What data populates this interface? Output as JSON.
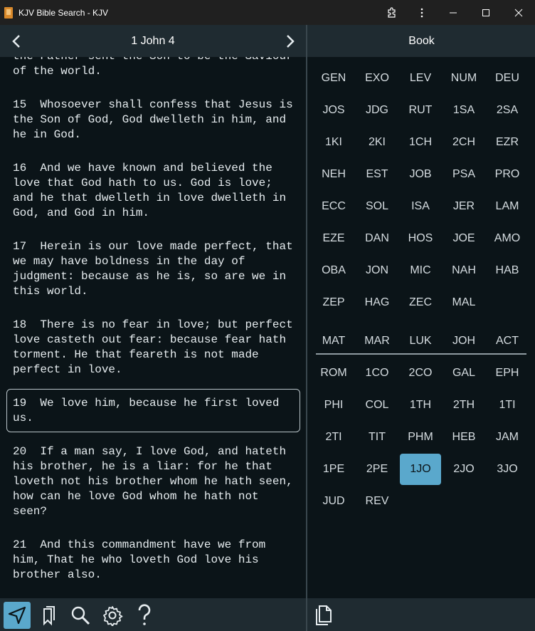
{
  "window": {
    "title": "KJV Bible Search - KJV",
    "icons": [
      "app-book-icon",
      "extensions-icon",
      "more-vert-icon",
      "minimize-icon",
      "maximize-icon",
      "close-icon"
    ]
  },
  "reader": {
    "chapter_title": "1 John 4",
    "prev_icon": "chevron-left-icon",
    "next_icon": "chevron-right-icon",
    "verses": [
      {
        "lines": [
          "the Father sent the Son to be the Saviour",
          "of the world."
        ]
      },
      {
        "lines": [
          "15  Whosoever shall confess that Jesus is",
          "the Son of God, God dwelleth in him, and",
          "he in God."
        ]
      },
      {
        "lines": [
          "16  And we have known and believed the",
          "love that God hath to us. God is love;",
          "and he that dwelleth in love dwelleth in",
          "God, and God in him."
        ]
      },
      {
        "lines": [
          "17  Herein is our love made perfect, that",
          "we may have boldness in the day of",
          "judgment: because as he is, so are we in",
          "this world."
        ]
      },
      {
        "lines": [
          "18  There is no fear in love; but perfect",
          "love casteth out fear: because fear hath",
          "torment. He that feareth is not made",
          "perfect in love."
        ]
      },
      {
        "lines": [
          "19  We love him, because he first loved",
          "us."
        ]
      },
      {
        "lines": [
          "20  If a man say, I love God, and hateth",
          "his brother, he is a liar: for he that",
          "loveth not his brother whom he hath seen,",
          "how can he love God whom he hath not",
          "seen?"
        ]
      },
      {
        "lines": [
          "21  And this commandment have we from",
          "him, That he who loveth God love his",
          "brother also."
        ]
      }
    ],
    "selected_verse_index": 5
  },
  "bottom_toolbar": {
    "buttons": [
      {
        "icon": "navigate-icon",
        "active": true
      },
      {
        "icon": "bookmarks-icon",
        "active": false
      },
      {
        "icon": "search-icon",
        "active": false
      },
      {
        "icon": "settings-icon",
        "active": false
      },
      {
        "icon": "help-icon",
        "active": false
      }
    ],
    "right_button_icon": "copy-icon"
  },
  "book_panel": {
    "title": "Book",
    "old_testament": [
      "GEN",
      "EXO",
      "LEV",
      "NUM",
      "DEU",
      "JOS",
      "JDG",
      "RUT",
      "1SA",
      "2SA",
      "1KI",
      "2KI",
      "1CH",
      "2CH",
      "EZR",
      "NEH",
      "EST",
      "JOB",
      "PSA",
      "PRO",
      "ECC",
      "SOL",
      "ISA",
      "JER",
      "LAM",
      "EZE",
      "DAN",
      "HOS",
      "JOE",
      "AMO",
      "OBA",
      "JON",
      "MIC",
      "NAH",
      "HAB",
      "ZEP",
      "HAG",
      "ZEC",
      "MAL"
    ],
    "new_testament": [
      "MAT",
      "MAR",
      "LUK",
      "JOH",
      "ACT",
      "ROM",
      "1CO",
      "2CO",
      "GAL",
      "EPH",
      "PHI",
      "COL",
      "1TH",
      "2TH",
      "1TI",
      "2TI",
      "TIT",
      "PHM",
      "HEB",
      "JAM",
      "1PE",
      "2PE",
      "1JO",
      "2JO",
      "3JO",
      "JUD",
      "REV"
    ],
    "selected_book": "1JO"
  },
  "colors": {
    "accent": "#5aa8cc",
    "background": "#0b1418",
    "header": "#1f2b31"
  }
}
